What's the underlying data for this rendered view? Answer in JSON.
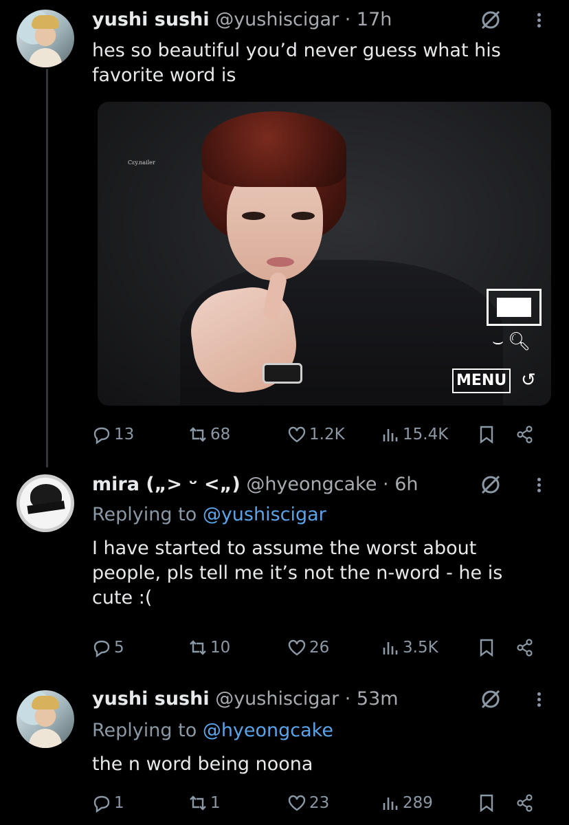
{
  "tweets": [
    {
      "name": "yushi sushi",
      "meta": "@yushiscigar · 17h",
      "text": "hes so beautiful you’d never guess what his favorite word is",
      "media": {
        "watermark": "Cεy.nailer",
        "menu_label": "MENU"
      },
      "actions": {
        "replies": "13",
        "reposts": "68",
        "likes": "1.2K",
        "views": "15.4K"
      }
    },
    {
      "name": "mira („> ᵕ <„)",
      "meta": "@hyeongcake · 6h",
      "replying_prefix": "Replying to",
      "replying_to": "@yushiscigar",
      "text": "I have started to assume the worst about people, pls tell me it’s not the n-word - he is cute :(",
      "actions": {
        "replies": "5",
        "reposts": "10",
        "likes": "26",
        "views": "3.5K"
      }
    },
    {
      "name": "yushi sushi",
      "meta": "@yushiscigar · 53m",
      "replying_prefix": "Replying to",
      "replying_to": "@hyeongcake",
      "text": "the n word being noona",
      "actions": {
        "replies": "1",
        "reposts": "1",
        "likes": "23",
        "views": "289"
      }
    }
  ],
  "icons": {
    "reply": "reply-icon",
    "repost": "repost-icon",
    "like": "heart-icon",
    "views": "views-icon",
    "bookmark": "bookmark-icon",
    "share": "share-icon",
    "grok": "grok-icon",
    "more": "more-icon"
  },
  "colors": {
    "background": "#000000",
    "text": "#e7e9ea",
    "muted": "#8b98a5",
    "link": "#5aa4ea"
  }
}
